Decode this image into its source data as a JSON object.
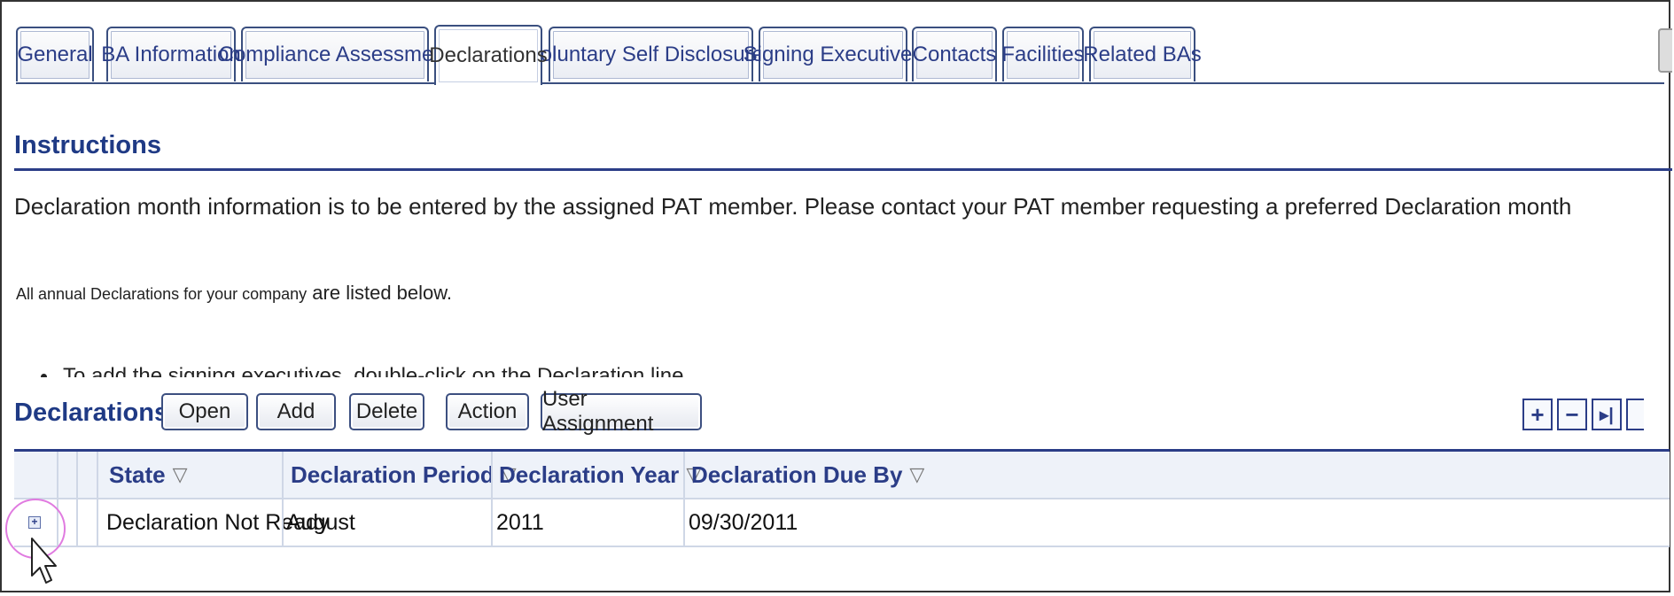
{
  "tabs": [
    {
      "label": "General",
      "active": false
    },
    {
      "label": "BA Information",
      "active": false
    },
    {
      "label": "Compliance Assessment",
      "active": false
    },
    {
      "label": "Declarations",
      "active": true
    },
    {
      "label": "Voluntary Self Disclosures",
      "active": false
    },
    {
      "label": "Signing Executives",
      "active": false
    },
    {
      "label": "Contacts",
      "active": false
    },
    {
      "label": "Facilities",
      "active": false
    },
    {
      "label": "Related BAs",
      "active": false
    }
  ],
  "instructions": {
    "title": "Instructions",
    "line1": "Declaration month information is to be entered by the assigned PAT member. Please contact your PAT member requesting a preferred Declaration month",
    "line2_small": "All annual Declarations for your company",
    "line2_big": " are listed below.",
    "bullet": "To add the signing executives, double-click on the Declaration line"
  },
  "declarations": {
    "title": "Declarations",
    "buttons": [
      "Open",
      "Add",
      "Delete",
      "Action",
      "User Assignment"
    ],
    "tools": [
      {
        "icon": "plus-icon",
        "glyph": "+"
      },
      {
        "icon": "minus-icon",
        "glyph": "−"
      },
      {
        "icon": "skip-end-icon",
        "glyph": "▸|"
      }
    ],
    "columns": [
      "State",
      "Declaration Period",
      "Declaration Year",
      "Declaration Due By"
    ],
    "filter_glyph": "▽",
    "rows": [
      {
        "state": "Declaration Not Ready",
        "period": "August",
        "year": "2011",
        "due": "09/30/2011"
      }
    ]
  },
  "colors": {
    "accent": "#2b3d87",
    "highlight": "#e07be0"
  }
}
